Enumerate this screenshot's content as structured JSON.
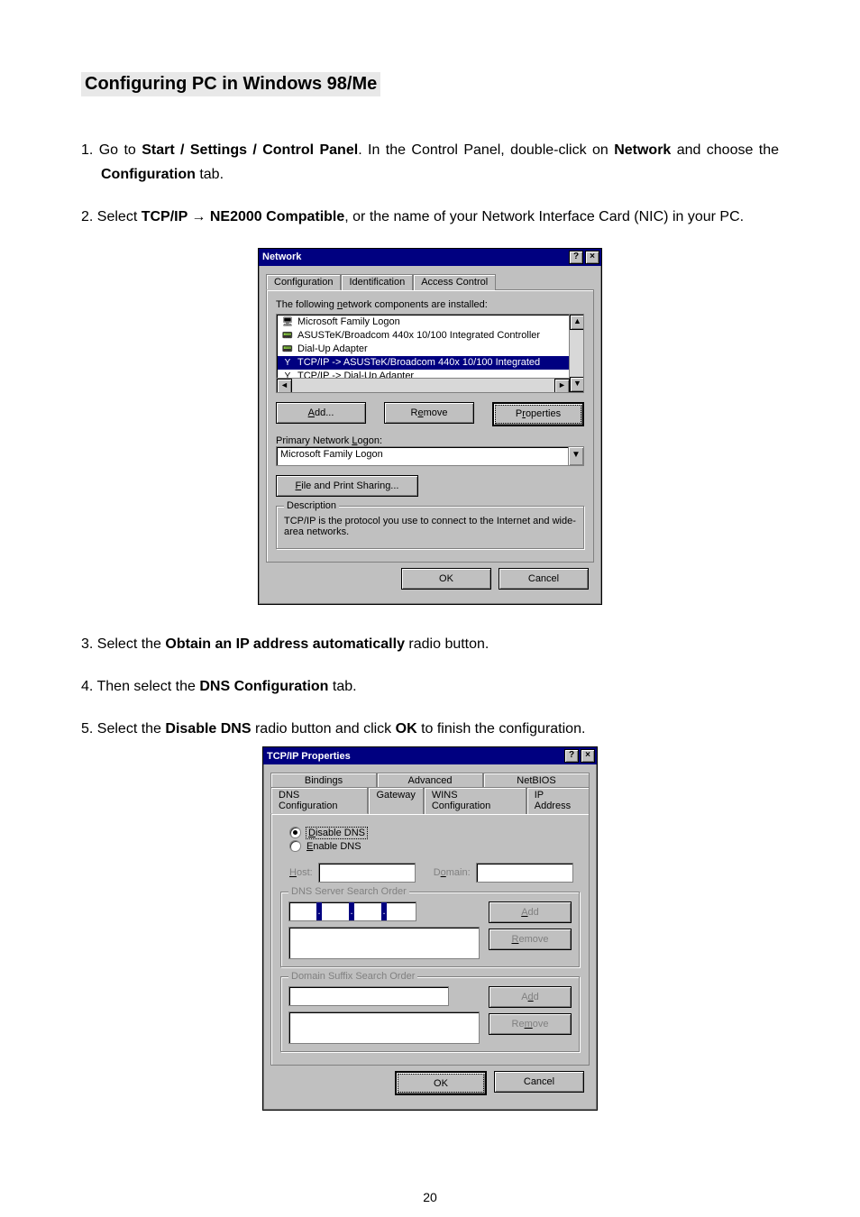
{
  "page_number": "20",
  "heading": "Configuring PC in Windows 98/Me",
  "steps": {
    "s1a": "1. Go to ",
    "s1b": "Start / Settings / Control Panel",
    "s1c": ". In the Control Panel, double-click on ",
    "s1d": "Network",
    "s1e": " and choose the ",
    "s1f": "Configuration",
    "s1g": " tab.",
    "s2a": "2. Select ",
    "s2b": "TCP/IP ",
    "s2arrow": "→",
    "s2c": " NE2000 Compatible",
    "s2d": ", or the name of your Network Interface Card (NIC) in your PC.",
    "s3a": "3. Select the ",
    "s3b": "Obtain an IP address automatically",
    "s3c": " radio button.",
    "s4a": "4. Then select the ",
    "s4b": "DNS Configuration",
    "s4c": " tab.",
    "s5a": "5. Select the ",
    "s5b": "Disable DNS",
    "s5c": " radio button and click ",
    "s5d": "OK",
    "s5e": " to finish the configuration."
  },
  "network_dialog": {
    "title": "Network",
    "help_btn": "?",
    "close_btn": "×",
    "tabs": {
      "configuration": "Configuration",
      "identification": "Identification",
      "access": "Access Control"
    },
    "label_installed": "The following network components are installed:",
    "items": [
      {
        "icon": "🖥",
        "label": "Microsoft Family Logon"
      },
      {
        "icon": "📟",
        "label": "ASUSTeK/Broadcom 440x 10/100 Integrated Controller"
      },
      {
        "icon": "📟",
        "label": "Dial-Up Adapter"
      },
      {
        "icon": "Y",
        "label": "TCP/IP -> ASUSTeK/Broadcom 440x 10/100 Integrated"
      },
      {
        "icon": "Y",
        "label": "TCP/IP -> Dial-Up Adapter"
      }
    ],
    "btn_add": "Add...",
    "btn_remove": "Remove",
    "btn_properties": "Properties",
    "label_logon": "Primary Network Logon:",
    "logon_value": "Microsoft Family Logon",
    "btn_fps": "File and Print Sharing...",
    "desc_title": "Description",
    "desc_text": "TCP/IP is the protocol you use to connect to the Internet and wide-area networks.",
    "btn_ok": "OK",
    "btn_cancel": "Cancel"
  },
  "tcpip_dialog": {
    "title": "TCP/IP Properties",
    "help_btn": "?",
    "close_btn": "×",
    "tabs_row1": {
      "bindings": "Bindings",
      "advanced": "Advanced",
      "netbios": "NetBIOS"
    },
    "tabs_row2": {
      "dns": "DNS Configuration",
      "gateway": "Gateway",
      "wins": "WINS Configuration",
      "ip": "IP Address"
    },
    "radio_disable": "Disable DNS",
    "radio_enable": "Enable DNS",
    "host_label": "Host:",
    "domain_label": "Domain:",
    "group_dns": "DNS Server Search Order",
    "group_suffix": "Domain Suffix Search Order",
    "btn_add": "Add",
    "btn_remove": "Remove",
    "btn_ok": "OK",
    "btn_cancel": "Cancel"
  }
}
